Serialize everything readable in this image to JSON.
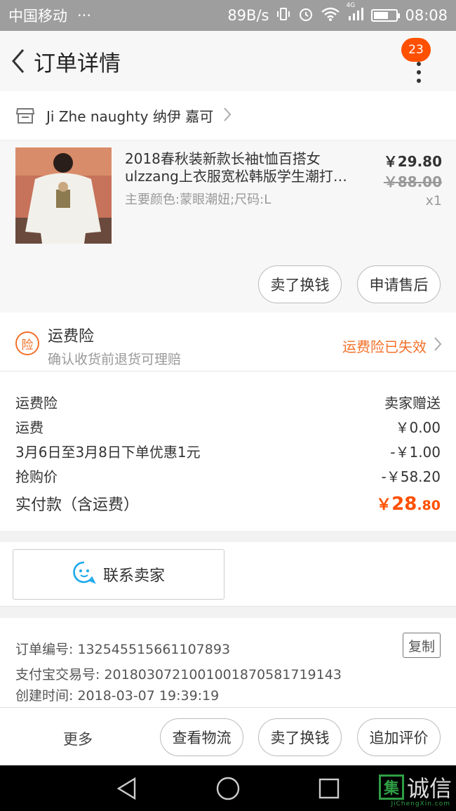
{
  "status_bar": {
    "carrier": "中国移动",
    "dots": "···",
    "speed": "89B/s",
    "network_badge": "4G",
    "time": "08:08",
    "battery_level": 0.65,
    "icons": [
      "vibrate-icon",
      "alarm-icon",
      "wifi-icon",
      "signal-icon",
      "battery-icon"
    ]
  },
  "header": {
    "title": "订单详情",
    "badge_count": "23"
  },
  "shop": {
    "name": "Ji Zhe naughty 纳伊 嘉可"
  },
  "product": {
    "title": "2018春秋装新款长袖t恤百搭女ulzzang上衣服宽松韩版学生潮打…",
    "sku": "主要颜色:蒙眼潮妞;尺码:L",
    "price": "￥29.80",
    "original_price": "￥88.00",
    "quantity": "x1",
    "buttons": {
      "resell": "卖了换钱",
      "after_sale": "申请售后"
    }
  },
  "insurance": {
    "icon_text": "险",
    "title": "运费险",
    "subtitle": "确认收货前退货可理赔",
    "status": "运费险已失效"
  },
  "costs": {
    "rows": [
      {
        "label": "运费险",
        "value": "卖家赠送"
      },
      {
        "label": "运费",
        "value": "￥0.00"
      },
      {
        "label": "3月6日至3月8日下单优惠1元",
        "value": "-￥1.00"
      },
      {
        "label": "抢购价",
        "value": "-￥58.20"
      }
    ],
    "total_label": "实付款（含运费）",
    "total_symbol": "￥",
    "total_int": "28",
    "total_dec": ".80"
  },
  "contact": {
    "label": "联系卖家"
  },
  "order_info": {
    "order_no": "订单编号: 132545515661107893",
    "alipay_no": "支付宝交易号: 2018030721001001870581719143",
    "created": "创建时间: 2018-03-07 19:39:19",
    "copy_label": "复制"
  },
  "bottom_bar": {
    "more": "更多",
    "logistics": "查看物流",
    "resell": "卖了换钱",
    "review": "追加评价"
  },
  "watermark": {
    "logo_char": "集",
    "text": "诚信",
    "sub": "JiChengXin.com"
  },
  "colors": {
    "accent": "#ff5000",
    "insurance_orange": "#f3702a",
    "status_bar": "#9e9e9e"
  }
}
